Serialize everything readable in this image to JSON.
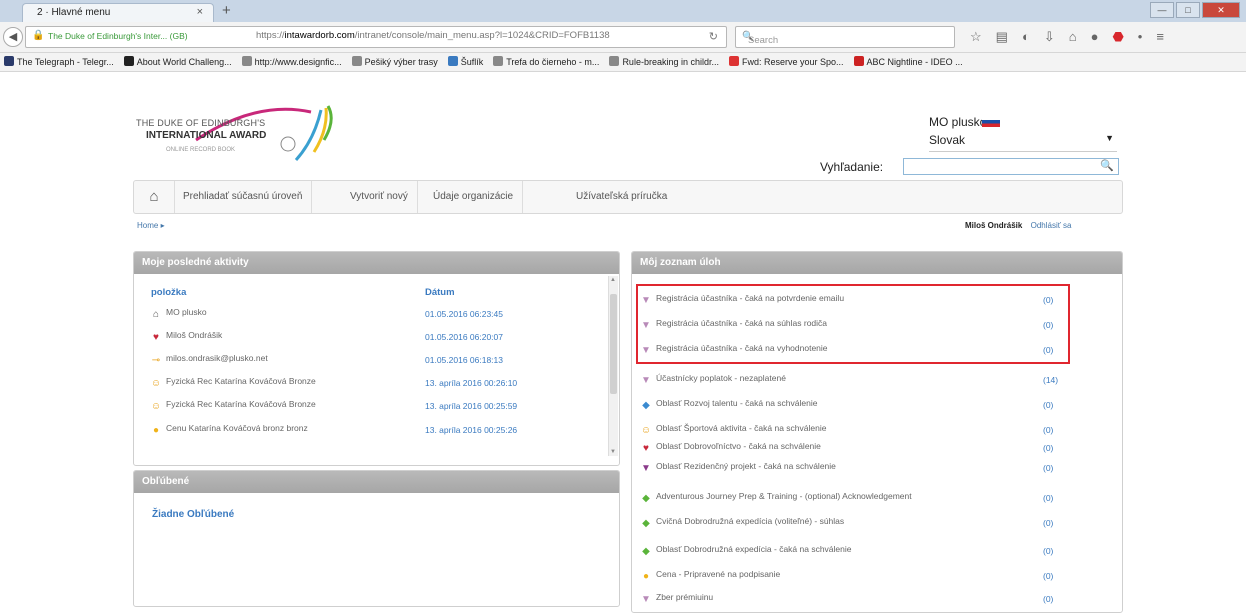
{
  "browser": {
    "tab_title": "2 · Hlavné menu",
    "site_label": "The Duke of Edinburgh's Inter... (GB)",
    "url_prefix": "https://",
    "url_domain": "intawardorb.com",
    "url_path": "/intranet/console/main_menu.asp?l=1024&CRID=FOFB1138",
    "search_placeholder": "Search",
    "bookmarks": [
      {
        "label": "The Telegraph - Telegr...",
        "color": "#2a3a6a"
      },
      {
        "label": "About World Challeng...",
        "color": "#222"
      },
      {
        "label": "http://www.designfic...",
        "color": "#888"
      },
      {
        "label": "Pešiký výber trasy",
        "color": "#888"
      },
      {
        "label": "Šuflík",
        "color": "#3a7ac0"
      },
      {
        "label": "Trefa do čierneho - m...",
        "color": "#888"
      },
      {
        "label": "Rule-breaking in childr...",
        "color": "#888"
      },
      {
        "label": "Fwd: Reserve your Spo...",
        "color": "#d33"
      },
      {
        "label": "ABC Nightline - IDEO ...",
        "color": "#c22"
      }
    ]
  },
  "header": {
    "logo_line1": "THE DUKE OF EDINBURGH'S",
    "logo_line2": "INTERNATIONAL AWARD",
    "logo_line3": "ONLINE RECORD BOOK",
    "user_name": "MO plusko",
    "language": "Slovak",
    "search_label": "Vyhľadanie:"
  },
  "menu": {
    "items": [
      "Prehliadať súčasnú úroveň",
      "Vytvoriť nový",
      "Údaje organizácie",
      "Užívateľská príručka"
    ]
  },
  "breadcrumb": "Home ▸",
  "user_links": {
    "name": "Miloš Ondrášik",
    "logout": "Odhlásiť sa"
  },
  "activities": {
    "title": "Moje posledné aktivity",
    "col_item": "položka",
    "col_date": "Dátum",
    "rows": [
      {
        "icon": "home-icon",
        "glyph": "⌂",
        "color": "#555",
        "text": "MO plusko",
        "date": "01.05.2016 06:23:45"
      },
      {
        "icon": "people-icon",
        "glyph": "♥",
        "color": "#c8283a",
        "text": "Miloš Ondrášik",
        "date": "01.05.2016 06:20:07"
      },
      {
        "icon": "key-icon",
        "glyph": "⊸",
        "color": "#e8a21a",
        "text": "milos.ondrasik@plusko.net",
        "date": "01.05.2016 06:18:13"
      },
      {
        "icon": "smiley-icon",
        "glyph": "☺",
        "color": "#e8a21a",
        "text": "Fyzická Rec Katarína Kováčová Bronze",
        "date": "13. apríla 2016 00:26:10"
      },
      {
        "icon": "smiley-icon",
        "glyph": "☺",
        "color": "#e8a21a",
        "text": "Fyzická Rec Katarína Kováčová Bronze",
        "date": "13. apríla 2016 00:25:59"
      },
      {
        "icon": "bulb-icon",
        "glyph": "●",
        "color": "#f0b31a",
        "text": "Cenu Katarína Kováčová bronz bronz",
        "date": "13. apríla 2016 00:25:26"
      }
    ]
  },
  "favorites": {
    "title": "Obľúbené",
    "empty_text": "Žiadne Obľúbené"
  },
  "tasks": {
    "title": "Môj zoznam úloh",
    "rows": [
      {
        "icon": "badge-icon",
        "glyph": "▼",
        "color": "#b88ab8",
        "text": "Registrácia účastníka - čaká na potvrdenie emailu",
        "count": "(0)"
      },
      {
        "icon": "badge-icon",
        "glyph": "▼",
        "color": "#b88ab8",
        "text": "Registrácia účastníka - čaká na súhlas rodiča",
        "count": "(0)"
      },
      {
        "icon": "badge-icon",
        "glyph": "▼",
        "color": "#b88ab8",
        "text": "Registrácia účastníka - čaká na vyhodnotenie",
        "count": "(0)"
      },
      {
        "icon": "badge-icon",
        "glyph": "▼",
        "color": "#b88ab8",
        "text": "Účastnícky poplatok - nezaplatené",
        "count": "(14)"
      },
      {
        "icon": "talent-icon",
        "glyph": "◆",
        "color": "#3a8ad0",
        "text": "Oblasť Rozvoj talentu - čaká na schválenie",
        "count": "(0)"
      },
      {
        "icon": "smiley-icon",
        "glyph": "☺",
        "color": "#e8a21a",
        "text": "Oblasť Športová aktivita - čaká na schválenie",
        "count": "(0)"
      },
      {
        "icon": "people-icon",
        "glyph": "♥",
        "color": "#c8283a",
        "text": "Oblasť Dobrovoľníctvo - čaká na schválenie",
        "count": "(0)"
      },
      {
        "icon": "heart-icon",
        "glyph": "▼",
        "color": "#8a3a8a",
        "text": "Oblasť Rezidenčný projekt - čaká na schválenie",
        "count": "(0)"
      },
      {
        "icon": "compass-icon",
        "glyph": "◆",
        "color": "#5ab43a",
        "text": "Adventurous Journey Prep & Training - (optional) Acknowledgement",
        "count": "(0)"
      },
      {
        "icon": "compass-icon",
        "glyph": "◆",
        "color": "#5ab43a",
        "text": "Cvičná Dobrodružná expedícia (voliteľné) - súhlas",
        "count": "(0)"
      },
      {
        "icon": "compass-icon",
        "glyph": "◆",
        "color": "#5ab43a",
        "text": "Oblasť Dobrodružná expedícia - čaká na schválenie",
        "count": "(0)"
      },
      {
        "icon": "bulb-icon",
        "glyph": "●",
        "color": "#f0b31a",
        "text": "Cena - Pripravené na podpisanie",
        "count": "(0)"
      },
      {
        "icon": "badge-icon",
        "glyph": "▼",
        "color": "#b88ab8",
        "text": "Zber prémiuinu",
        "count": "(0)"
      }
    ]
  }
}
